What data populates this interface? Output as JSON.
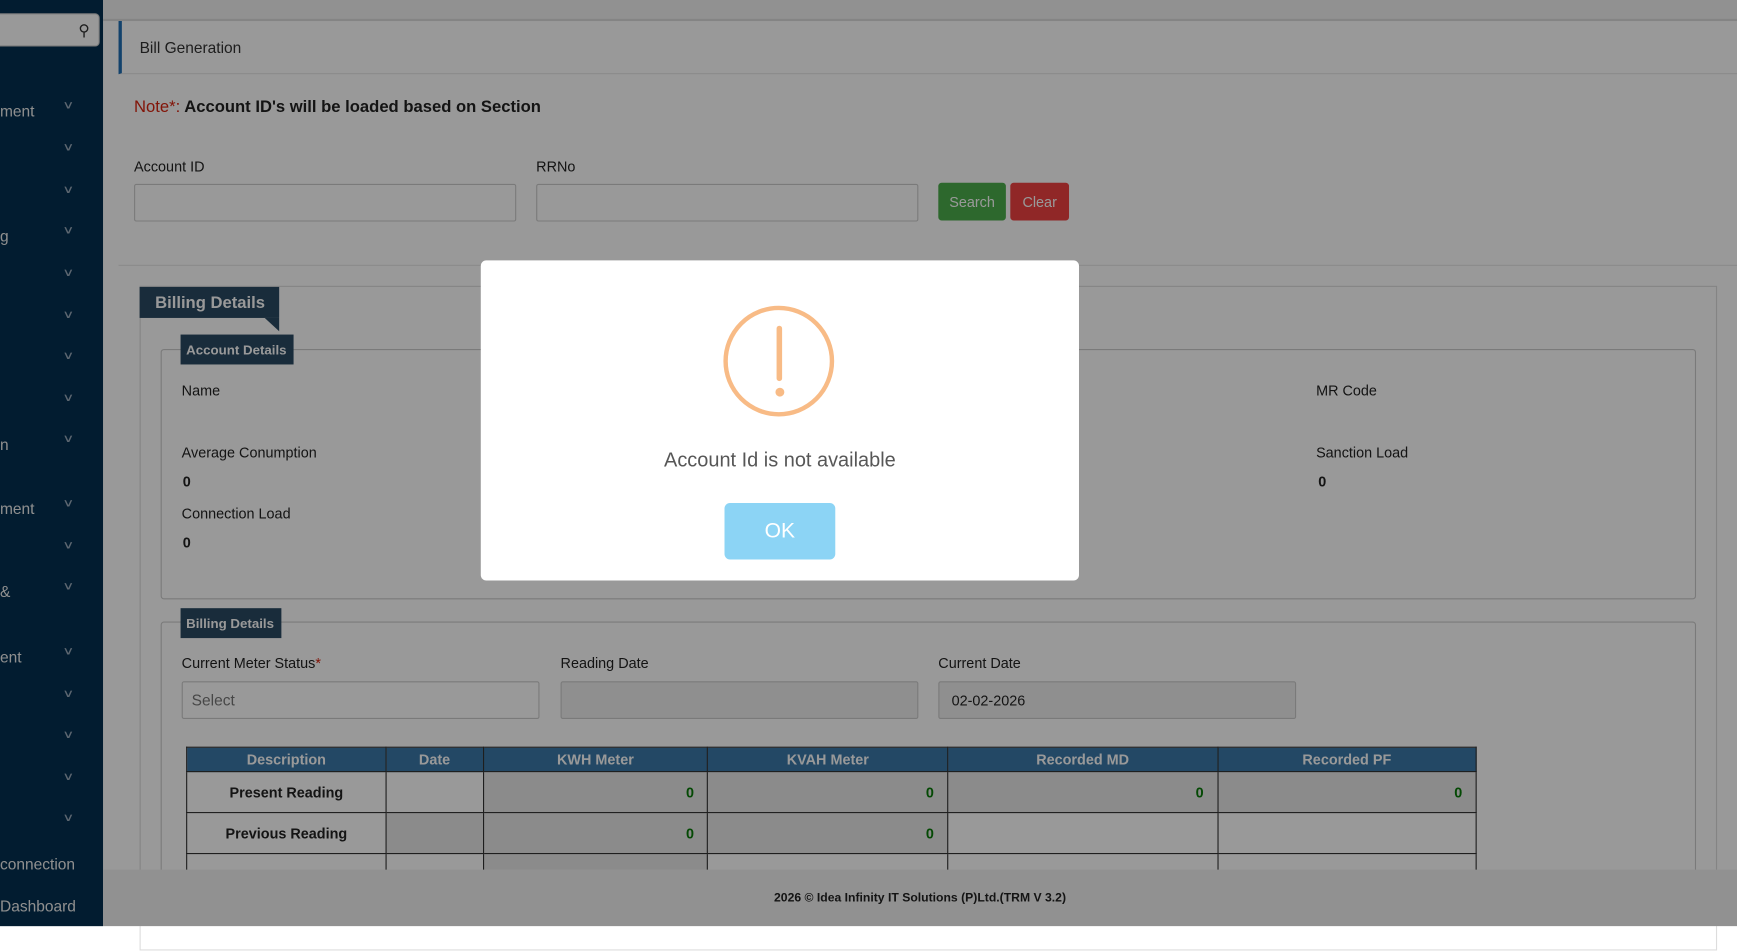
{
  "sidebar": {
    "items": [
      {
        "label": "ment"
      },
      {
        "label": ""
      },
      {
        "label": ""
      },
      {
        "label": "g"
      },
      {
        "label": ""
      },
      {
        "label": ""
      },
      {
        "label": ""
      },
      {
        "label": ""
      },
      {
        "label": "n"
      },
      {
        "label": "ment"
      },
      {
        "label": ""
      },
      {
        "label": "&"
      },
      {
        "label": "ent"
      },
      {
        "label": ""
      },
      {
        "label": ""
      },
      {
        "label": ""
      },
      {
        "label": ""
      },
      {
        "label": "connection"
      },
      {
        "label": "Dashboard"
      }
    ]
  },
  "header": {
    "title": "Bill Generation"
  },
  "note": {
    "prefix": "Note*:",
    "text": " Account ID's will be loaded based on Section"
  },
  "search": {
    "account_id_label": "Account ID",
    "account_id_value": "",
    "rrno_label": "RRNo",
    "rrno_value": "",
    "search_label": "Search",
    "clear_label": "Clear"
  },
  "billing": {
    "title": "Billing Details",
    "account_details": {
      "title": "Account Details",
      "name_label": "Name",
      "mr_code_label": "MR Code",
      "avg_label": "Average Conumption",
      "avg_value": "0",
      "sanction_label": "Sanction Load",
      "sanction_value": "0",
      "conn_label": "Connection Load",
      "conn_value": "0"
    },
    "billing_details": {
      "title": "Billing Details",
      "meter_status_label": "Current Meter Status",
      "required": "*",
      "meter_status_placeholder": "Select",
      "reading_date_label": "Reading Date",
      "current_date_label": "Current Date",
      "current_date_value": "02-02-2026"
    },
    "table": {
      "headers": [
        "Description",
        "Date",
        "KWH Meter",
        "KVAH Meter",
        "Recorded MD",
        "Recorded PF"
      ],
      "rows": [
        {
          "desc": "Present Reading",
          "kwh": "0",
          "kvah": "0",
          "md": "0",
          "pf": "0"
        },
        {
          "desc": "Previous Reading",
          "kwh": "0",
          "kvah": "0"
        }
      ]
    }
  },
  "footer": {
    "text": "2026 © Idea Infinity IT Solutions (P)Ltd.(TRM V 3.2)"
  },
  "modal": {
    "message": "Account Id is not available",
    "ok_label": "OK",
    "icon": "warning-icon"
  }
}
